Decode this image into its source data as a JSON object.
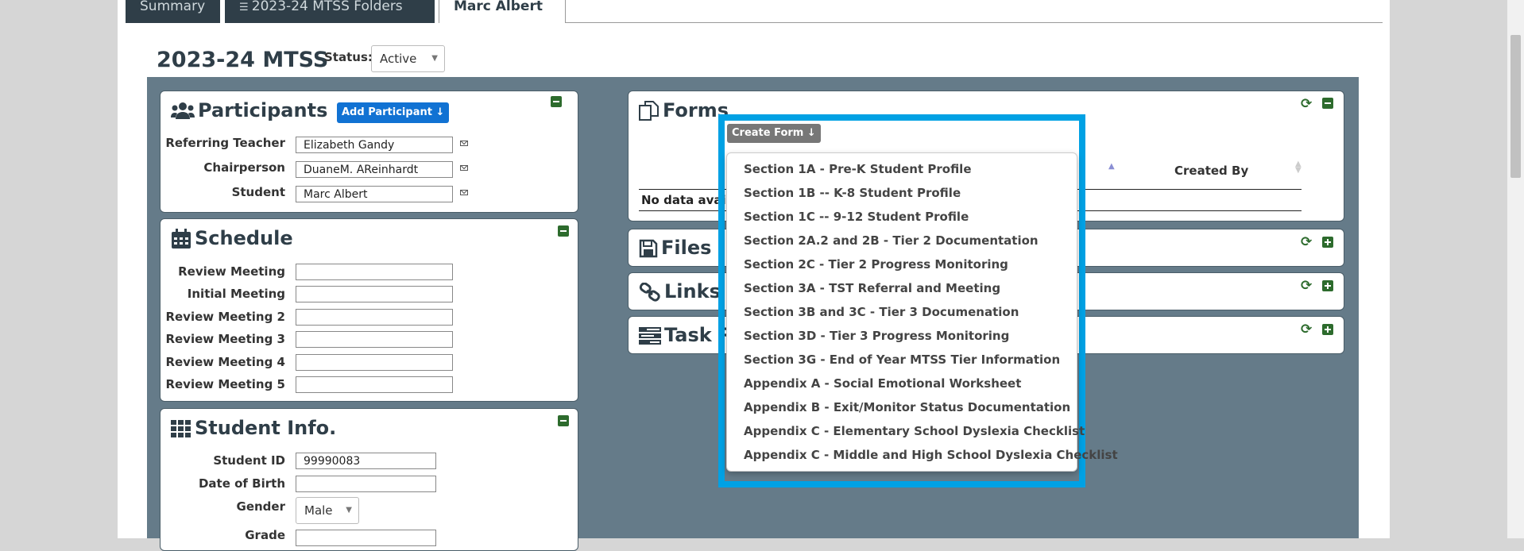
{
  "tabs": [
    "Summary",
    "2023-24 MTSS Folders",
    "Marc Albert"
  ],
  "page_title": "2023-24 MTSS",
  "status": {
    "label": "Status:",
    "value": "Active"
  },
  "participants": {
    "title": "Participants",
    "add_button": "Add Participant ↓",
    "rows": [
      {
        "label": "Referring Teacher",
        "value": "Elizabeth Gandy"
      },
      {
        "label": "Chairperson",
        "value": "DuaneM. AReinhardt"
      },
      {
        "label": "Student",
        "value": "Marc Albert"
      }
    ]
  },
  "schedule": {
    "title": "Schedule",
    "rows": [
      "Review Meeting",
      "Initial Meeting",
      "Review Meeting 2",
      "Review Meeting 3",
      "Review Meeting 4",
      "Review Meeting 5"
    ]
  },
  "student_info": {
    "title": "Student Info.",
    "student_id_label": "Student ID",
    "student_id": "99990083",
    "dob_label": "Date of Birth",
    "gender_label": "Gender",
    "gender": "Male",
    "grade_label": "Grade"
  },
  "forms": {
    "title": "Forms",
    "create_button": "Create Form ↓",
    "col_created_by": "Created By",
    "empty_text": "No data availa",
    "menu_items": [
      "Section 1A - Pre-K Student Profile",
      "Section 1B -- K-8 Student Profile",
      "Section 1C -- 9-12 Student Profile",
      "Section 2A.2 and 2B - Tier 2 Documentation",
      "Section 2C - Tier 2 Progress Monitoring",
      "Section 3A - TST Referral and Meeting",
      "Section 3B and 3C - Tier 3 Documenation",
      "Section 3D - Tier 3 Progress Monitoring",
      "Section 3G - End of Year MTSS Tier Information",
      "Appendix A - Social Emotional Worksheet",
      "Appendix B - Exit/Monitor Status Documentation",
      "Appendix C - Elementary School Dyslexia Checklist",
      "Appendix C - Middle and High School Dyslexia Checklist"
    ]
  },
  "files": {
    "title": "Files"
  },
  "links": {
    "title": "Links"
  },
  "tasks": {
    "title": "Task Re"
  },
  "colors": {
    "accent": "#1172d3",
    "highlight": "#00a1e4",
    "panel_bg": "#657b89",
    "toggle_green": "#2d6b2d"
  }
}
